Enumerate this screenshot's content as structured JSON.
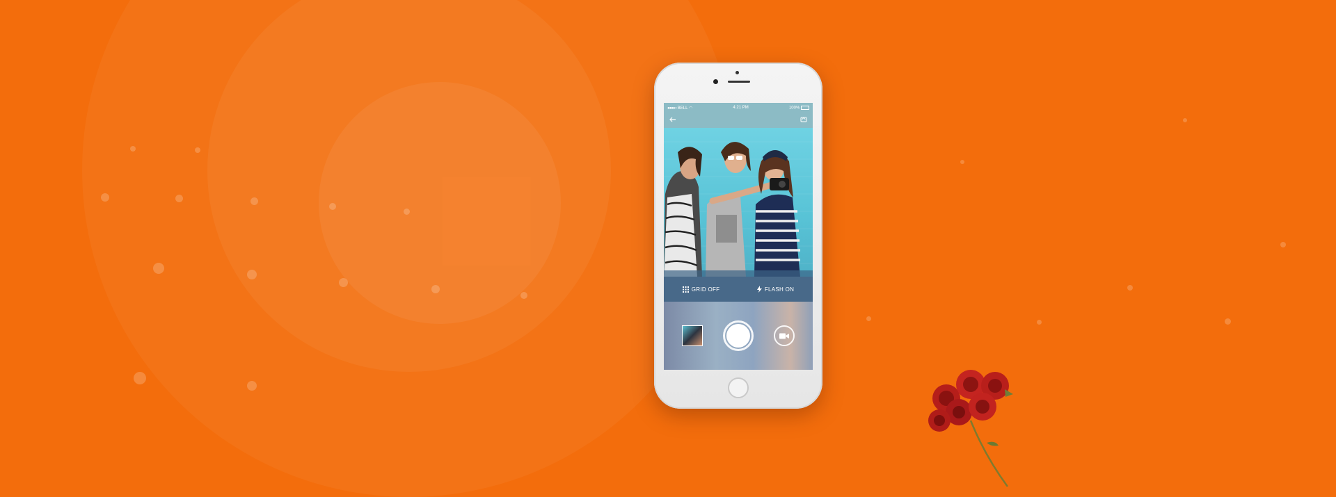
{
  "status_bar": {
    "carrier": "BELL",
    "time": "4:21 PM",
    "battery": "100%"
  },
  "top_bar": {
    "back_icon": "arrow-left-icon",
    "switch_icon": "camera-switch-icon"
  },
  "controls": {
    "grid_label": "GRID OFF",
    "grid_icon": "grid-icon",
    "flash_label": "FLASH ON",
    "flash_icon": "flash-icon"
  },
  "capture": {
    "thumbnail_icon": "gallery-thumbnail",
    "shutter_icon": "shutter-button",
    "video_icon": "video-camera-icon"
  },
  "colors": {
    "background": "#f36d0c",
    "controls_bar": "#415f82",
    "accent": "#ffffff"
  }
}
